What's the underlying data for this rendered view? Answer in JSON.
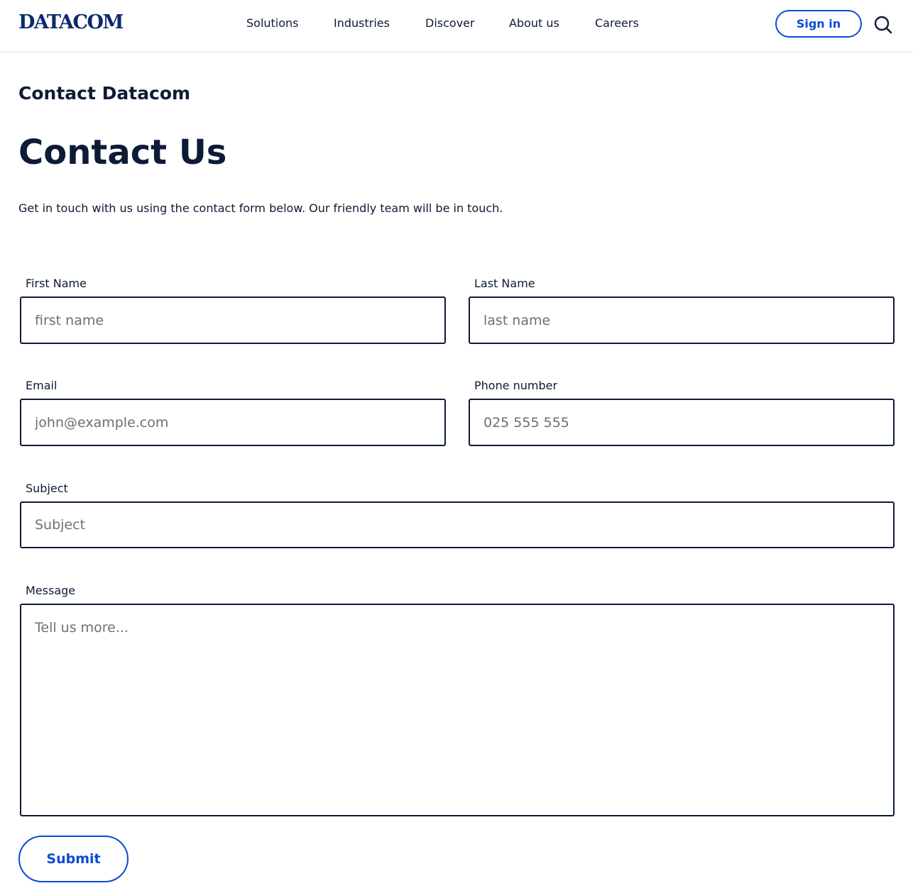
{
  "header": {
    "logo": "DATACOM",
    "nav": [
      "Solutions",
      "Industries",
      "Discover",
      "About us",
      "Careers"
    ],
    "signin_label": "Sign in",
    "search_icon": "search-icon"
  },
  "page": {
    "eyebrow": "Contact Datacom",
    "title": "Contact Us",
    "intro": "Get in touch with us using the contact form below. Our friendly team will be in touch."
  },
  "form": {
    "first_name": {
      "label": "First Name",
      "placeholder": "first name",
      "value": ""
    },
    "last_name": {
      "label": "Last Name",
      "placeholder": "last name",
      "value": ""
    },
    "email": {
      "label": "Email",
      "placeholder": "john@example.com",
      "value": ""
    },
    "phone": {
      "label": "Phone number",
      "placeholder": "025 555 555",
      "value": ""
    },
    "subject": {
      "label": "Subject",
      "placeholder": "Subject",
      "value": ""
    },
    "message": {
      "label": "Message",
      "placeholder": "Tell us more...",
      "value": ""
    },
    "submit_label": "Submit"
  },
  "colors": {
    "brand": "#0b2a6e",
    "accent": "#0a4bd6",
    "text": "#0d1b34",
    "border": "#0d1b34",
    "placeholder": "#6f6f6f",
    "divider": "#d9dce1"
  }
}
